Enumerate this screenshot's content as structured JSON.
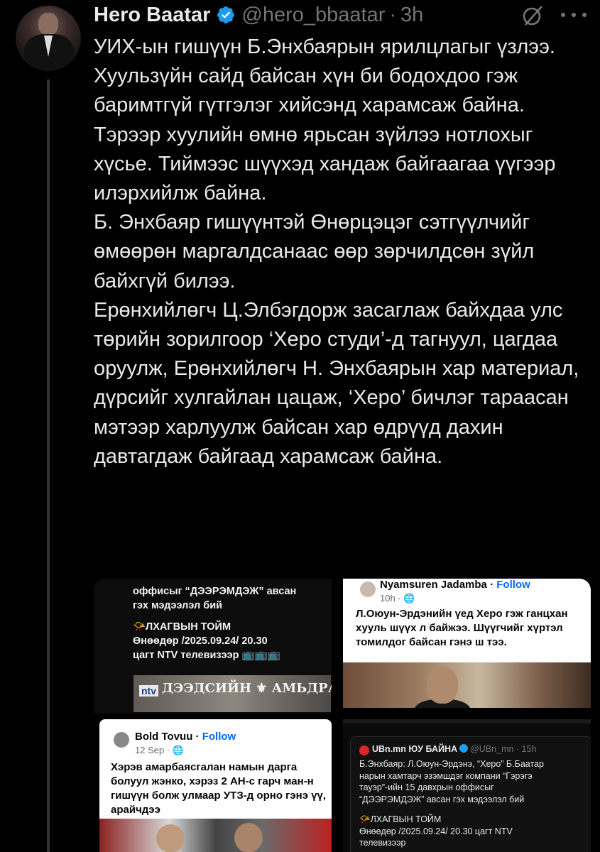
{
  "tweet": {
    "author_name": "Hero Baatar",
    "handle": "@hero_bbaatar",
    "separator": "·",
    "time": "3h",
    "paragraphs": [
      "УИХ-ын гишүүн Б.Энхбаярын ярилцлагыг үзлээ.",
      "Хуульзүйн сайд байсан хүн би бодохдоо гэж баримтгүй гүтгэлэг хийсэнд харамсаж байна.",
      "Тэрээр хуулийн өмнө ярьсан зүйлээ нотлохыг хүсье. Тиймээс шүүхэд хандаж байгаагаа үүгээр илэрхийлж байна.",
      "Б. Энхбаяр гишүүнтэй Өнөрцэцэг сэтгүүлчийг өмөөрөн маргалдсанаас өөр зөрчилдсөн зүйл байхгүй билээ.",
      "Ерөнхийлөгч Ц.Элбэгдорж засаглаж байхдаа улс төрийн зорилгоор ‘Херо студи’-д тагнуул, цагдаа оруулж, Ерөнхийлөгч Н. Энхбаярын хар материал, дүрсийг хулгайлан цацаж, ‘Херо’ бичлэг тараасан мэтээр харлуулж байсан хар өдрүүд дахин давтагдаж байгаад харамсаж байна."
    ]
  },
  "media": {
    "panel1": {
      "lines": [
        "оффисыг “ДЭЭРЭМДЭЖ” авсан",
        "гэх мэдээлэл бий",
        "",
        "📯ЛХАГВЫН ТОЙМ",
        "Өнөөдөр /2025.09.24/ 20.30",
        "цагт NTV телевизээр 📺📺📺"
      ],
      "banner_channel": "ntv",
      "banner_show": "ДЭЭДСИЙН ⚜ АМЬДРАЛ"
    },
    "panel2": {
      "name": "Nyamsuren Jadamba",
      "follow_sep": " · ",
      "follow": "Follow",
      "meta": "10h · 🌐",
      "body": "Л.Оюун-Эрдэнийн үед Херо гэж ганцхан хууль шүүх л байжээ. Шүүгчийг хүртэл томилдог байсан гэнэ ш тээ."
    },
    "panel3": {
      "name": "Bold Tovuu",
      "follow_sep": " · ",
      "follow": "Follow",
      "meta": "12 Sep · 🌐",
      "body": "Хэрэв амарбаясгалан намын дарга болуул жэнко, хэрэз 2 АН-с гарч ман-н гишүүн болж улмаар УТЗ-д орно гэнэ үү, арайчдээ"
    },
    "panel4": {
      "name": "UBn.mn ЮУ БАЙНА",
      "handle": "@UBn_mn · 15h",
      "lines": [
        "Б.Энхбаяр: Л.Оюун-Эрдэнэ, “Херо” Б.Баатар",
        "нарын хамтарч эзэмшдэг компани “Гэрэгэ",
        "тауэр”-ийн 15 давхрын оффисыг",
        "“ДЭЭРЭМДЭЖ” авсан гэх мэдээлэл бий",
        "",
        "📯ЛХАГВЫН ТОЙМ",
        "Өнөөдөр /2025.09.24/ 20.30 цагт NTV",
        "телевизээр"
      ]
    }
  },
  "colors": {
    "background": "#000000",
    "text": "#e7e9ea",
    "muted": "#71767b",
    "verified": "#1d9bf0",
    "link": "#0866ff"
  }
}
